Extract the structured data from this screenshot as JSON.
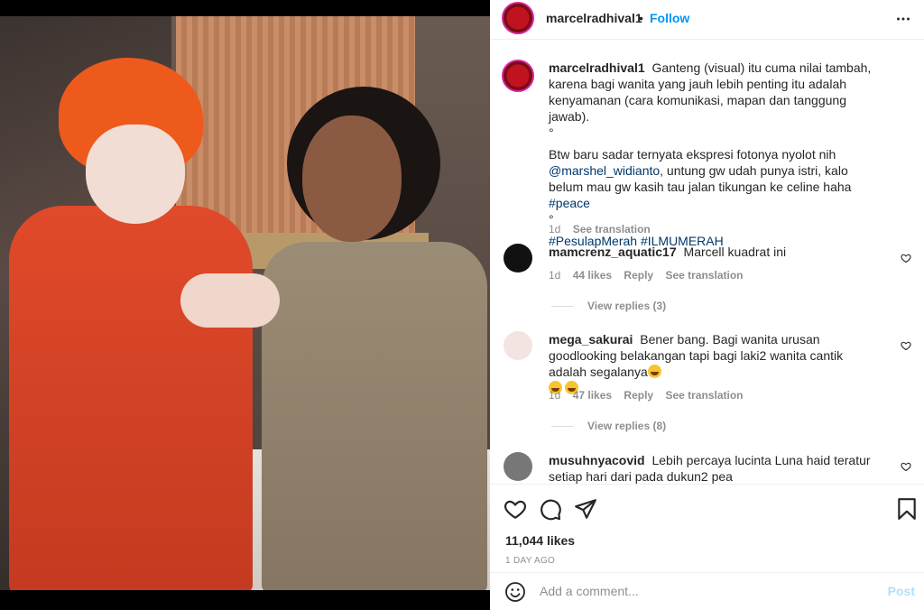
{
  "post": {
    "author": "marcelradhival1",
    "follow_label": "Follow",
    "dot": "•",
    "caption": {
      "username": "marcelradhival1",
      "line1": "Ganteng (visual) itu cuma nilai tambah, karena bagi wanita yang jauh lebih penting itu adalah kenyamanan (cara komunikasi, mapan dan tanggung jawab).",
      "sep1": "°",
      "line2_a": "Btw baru sadar ternyata ekspresi fotonya nyolot nih",
      "mention": "@marshel_widianto",
      "line2_b": ", untung gw udah punya istri, kalo belum mau gw kasih tau jalan tikungan ke celine haha",
      "hashtag_peace": "#peace",
      "sep2": "°",
      "hashtags": "#PesulapMerah #ILMUMERAH",
      "time": "1d",
      "see_translation": "See translation"
    }
  },
  "comments": [
    {
      "username": "mamcrenz_aquatic17",
      "text": "Marcell kuadrat ini",
      "time": "1d",
      "likes": "44 likes",
      "reply": "Reply",
      "see_translation": "See translation",
      "view_replies": "View replies (3)"
    },
    {
      "username": "mega_sakurai",
      "text": "Bener bang. Bagi wanita urusan goodlooking belakangan tapi bagi laki2 wanita cantik adalah segalanya",
      "time": "1d",
      "likes": "47 likes",
      "reply": "Reply",
      "see_translation": "See translation",
      "view_replies": "View replies (8)"
    },
    {
      "username": "musuhnyacovid",
      "text": "Lebih percaya lucinta Luna haid teratur setiap hari dari pada dukun2 pea"
    }
  ],
  "actions": {
    "likes": "11,044 likes",
    "ago": "1 DAY AGO"
  },
  "add_comment": {
    "placeholder": "Add a comment...",
    "post_label": "Post"
  },
  "colors": {
    "accent": "#0095f6",
    "post_disabled": "#b2dffc",
    "jacket": "#e04a2a",
    "hair": "#ee5a1c"
  }
}
